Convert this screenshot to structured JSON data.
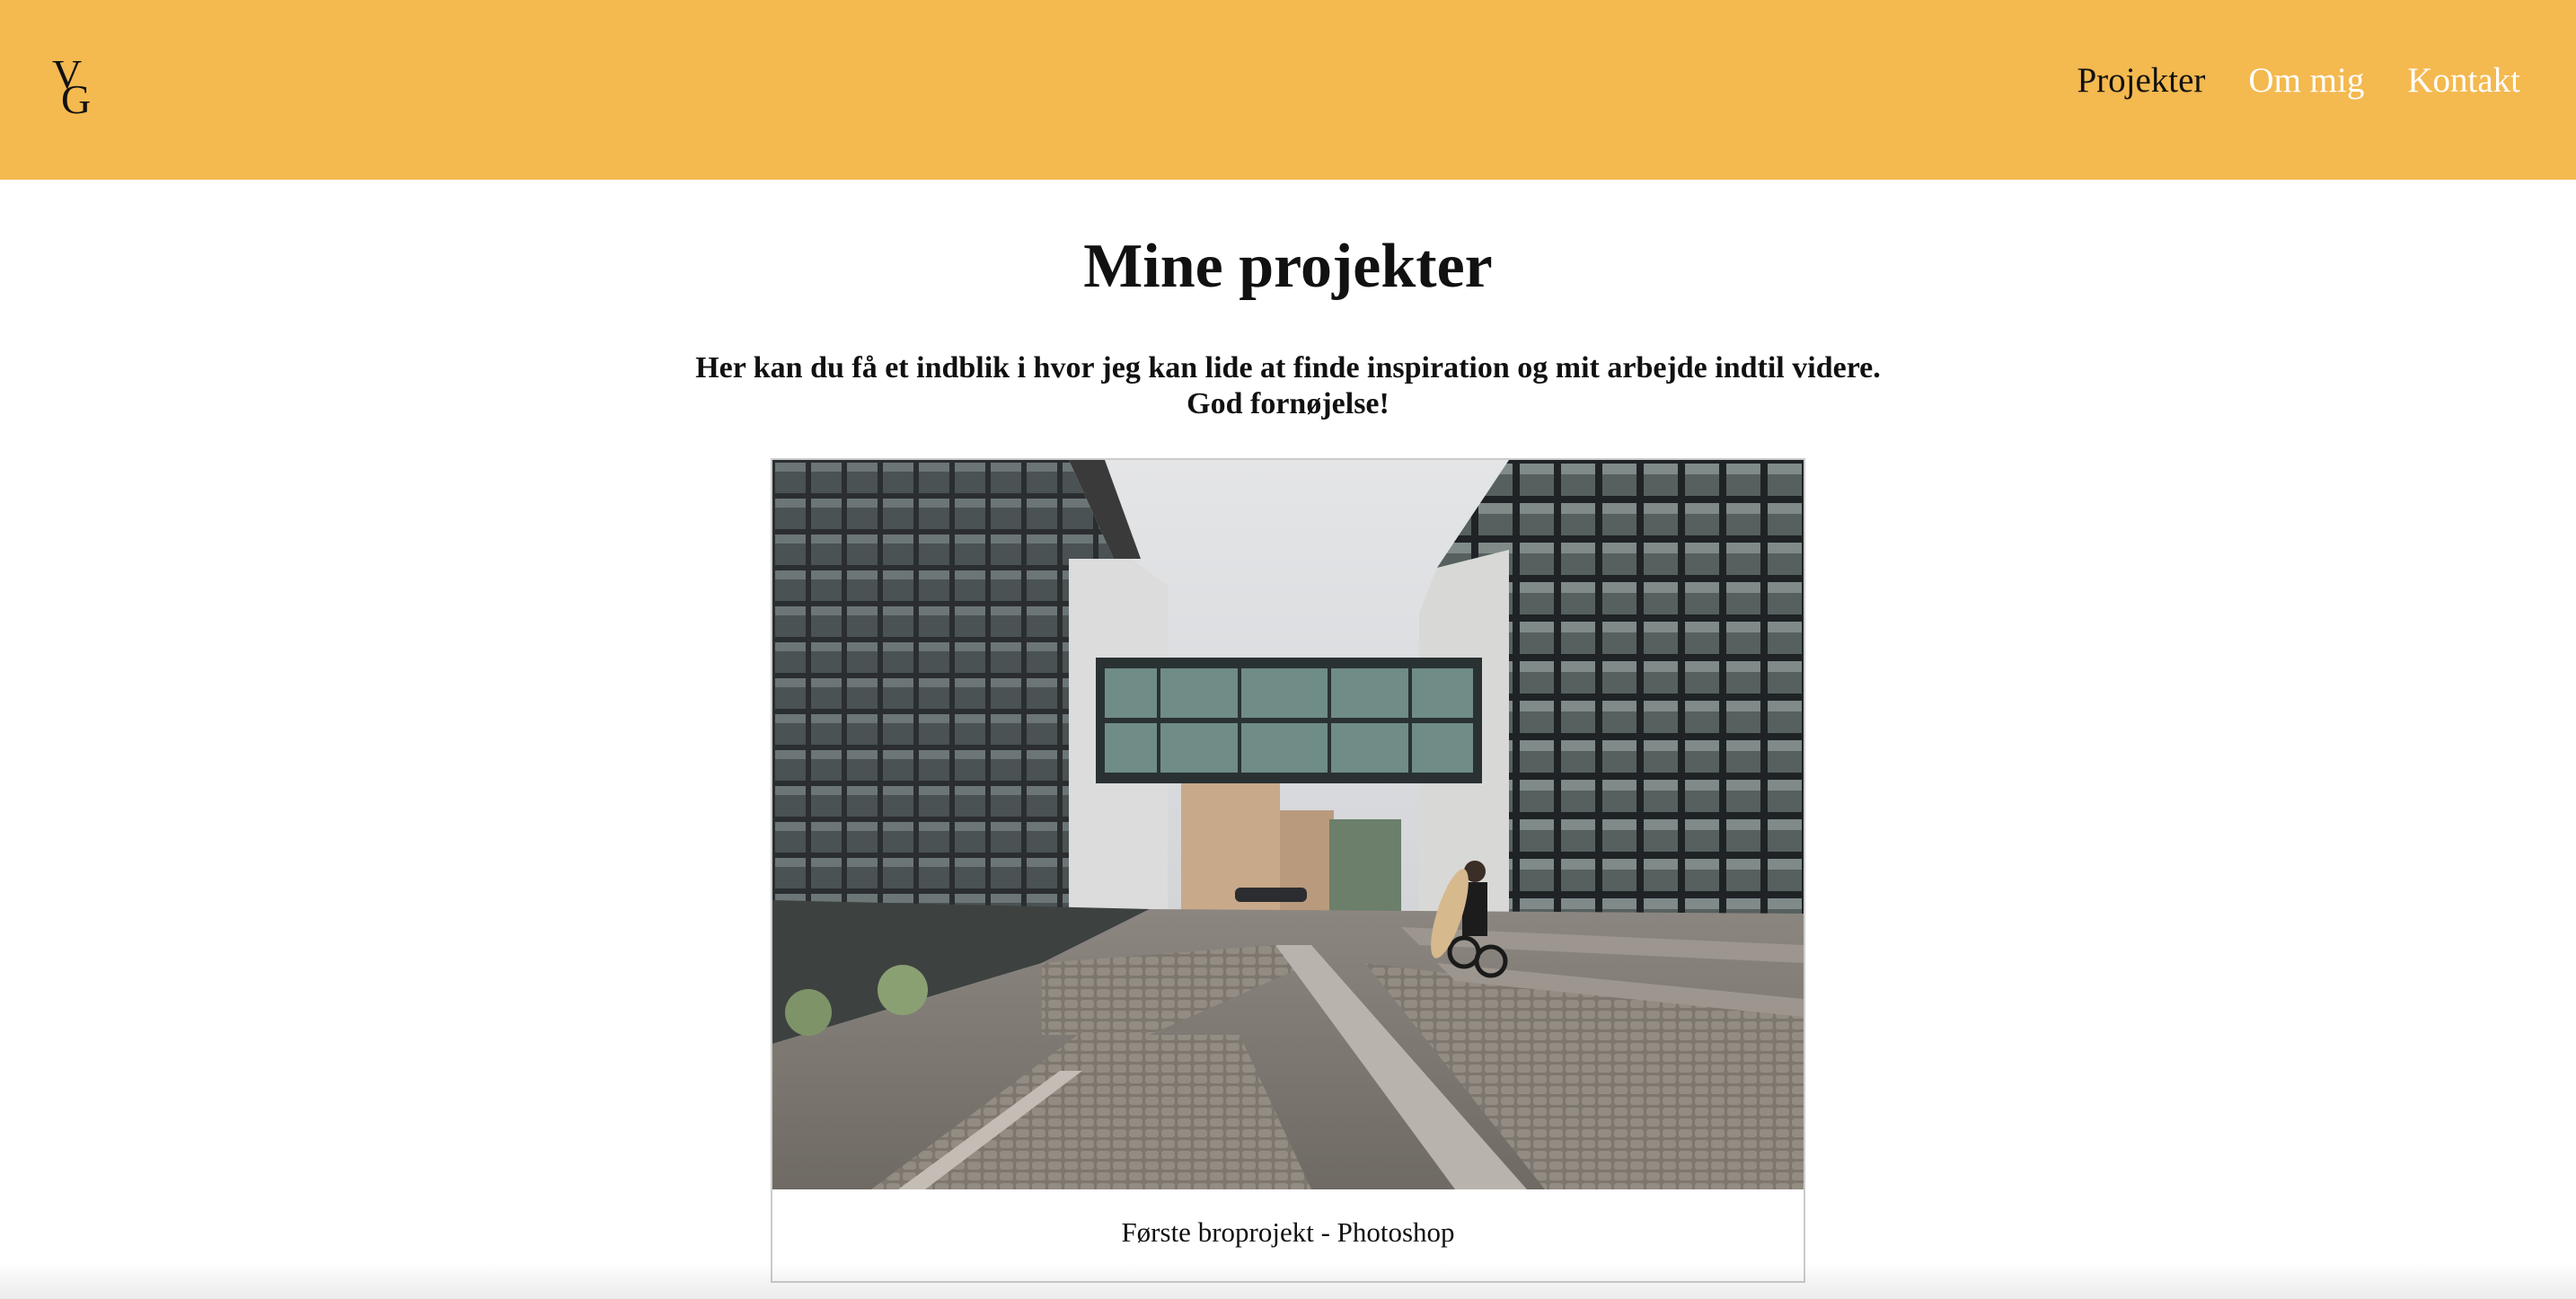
{
  "header": {
    "logo_text": "VG",
    "nav": [
      {
        "label": "Projekter",
        "active": true
      },
      {
        "label": "Om mig",
        "active": false
      },
      {
        "label": "Kontakt",
        "active": false
      }
    ]
  },
  "main": {
    "title": "Mine projekter",
    "intro_line1": "Her kan du få et indblik i hvor jeg kan lide at finde inspiration og mit arbejde indtil videre.",
    "intro_line2": "God fornøjelse!",
    "projects": [
      {
        "caption": "Første broprojekt - Photoshop"
      }
    ]
  },
  "colors": {
    "header_bg": "#f4b94f",
    "nav_active": "#111111",
    "nav_inactive": "#ffffff"
  }
}
